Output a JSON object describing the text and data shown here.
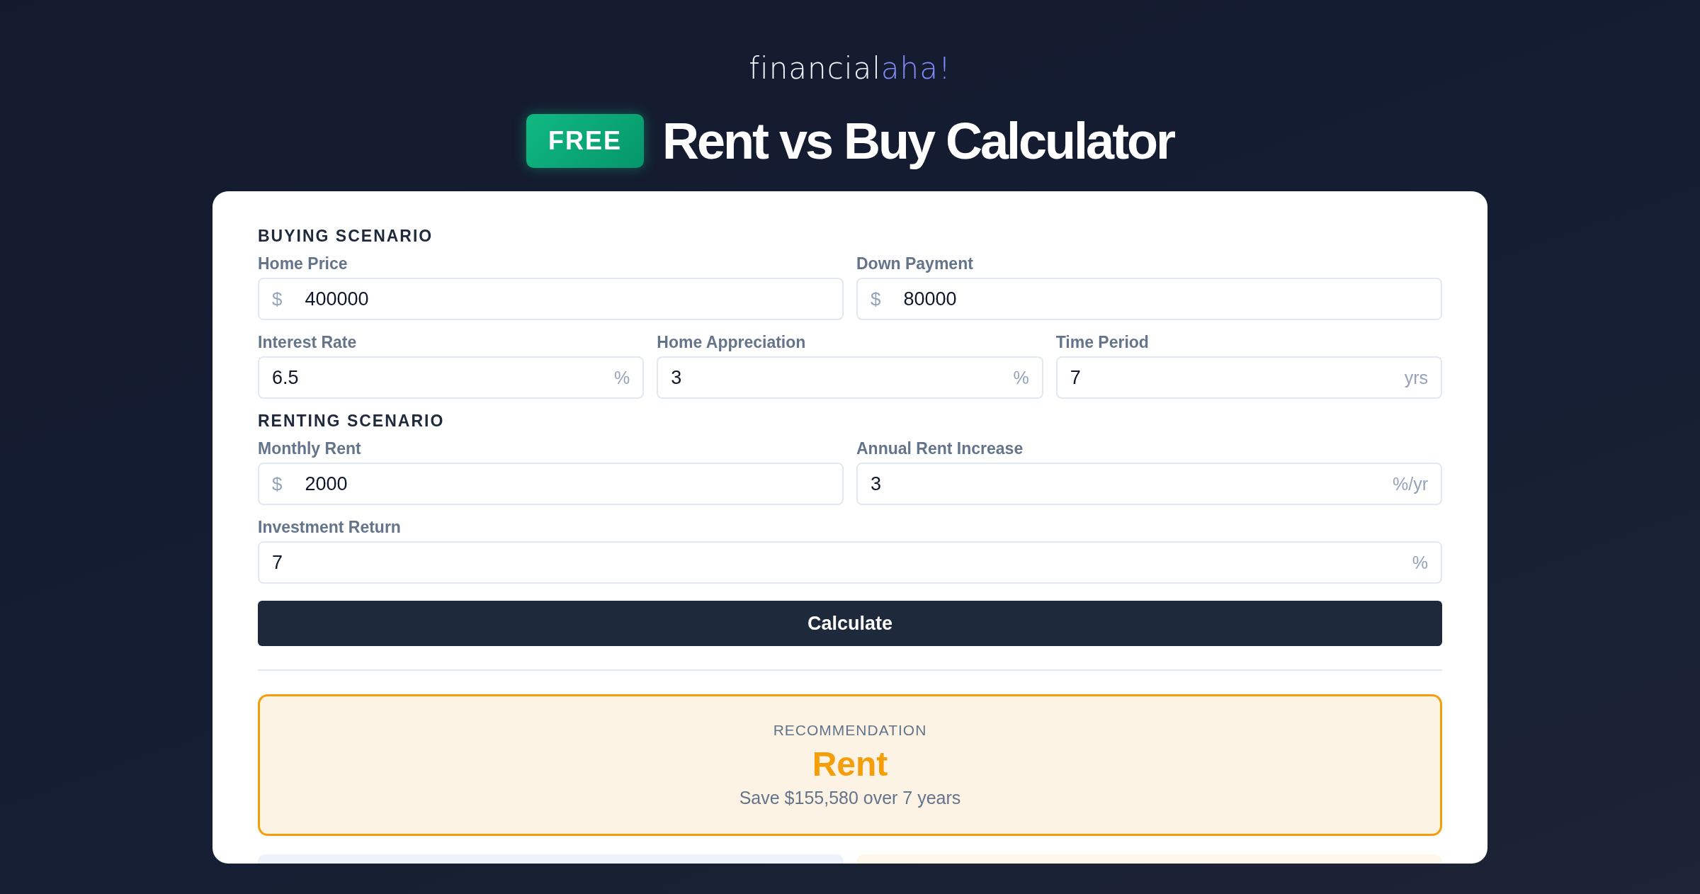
{
  "logo": {
    "main": "financial",
    "accent": "aha!"
  },
  "header": {
    "badge": "FREE",
    "title": "Rent vs Buy Calculator"
  },
  "sections": [
    {
      "heading": "BUYING SCENARIO",
      "rows": [
        [
          {
            "label": "Home Price",
            "prefix": "$",
            "value": "400000"
          },
          {
            "label": "Down Payment",
            "prefix": "$",
            "value": "80000"
          }
        ],
        [
          {
            "label": "Interest Rate",
            "value": "6.5",
            "suffix": "%"
          },
          {
            "label": "Home Appreciation",
            "value": "3",
            "suffix": "%"
          },
          {
            "label": "Time Period",
            "value": "7",
            "suffix": "yrs"
          }
        ]
      ]
    },
    {
      "heading": "RENTING SCENARIO",
      "rows": [
        [
          {
            "label": "Monthly Rent",
            "prefix": "$",
            "value": "2000"
          },
          {
            "label": "Annual Rent Increase",
            "value": "3",
            "suffix": "%/yr"
          }
        ],
        [
          {
            "label": "Investment Return",
            "value": "7",
            "suffix": "%"
          }
        ]
      ]
    }
  ],
  "calculate_button": "Calculate",
  "recommendation": {
    "label": "RECOMMENDATION",
    "choice": "Rent",
    "summary": "Save $155,580 over 7 years"
  }
}
